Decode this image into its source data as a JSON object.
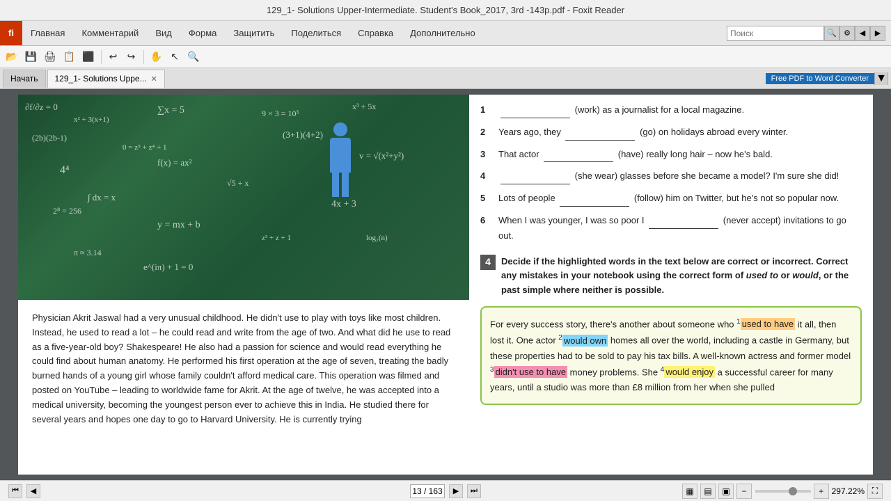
{
  "titleBar": {
    "title": "129_1- Solutions Upper-Intermediate. Student's Book_2017, 3rd -143p.pdf - Foxit Reader"
  },
  "menuBar": {
    "appLabel": "fi",
    "items": [
      "Главная",
      "Комментарий",
      "Вид",
      "Форма",
      "Защитить",
      "Поделиться",
      "Справка",
      "Дополнительно"
    ],
    "search": {
      "placeholder": "Поиск"
    }
  },
  "toolbar": {
    "buttons": [
      "💾",
      "🖨",
      "📋",
      "⬛",
      "↩",
      "↪",
      "🖊"
    ]
  },
  "tabs": {
    "home": "Начать",
    "current": "129_1- Solutions Uppe...",
    "converter": "Free PDF to Word Converter"
  },
  "leftPage": {
    "bodyText": "Physician Akrit Jaswal had a very unusual childhood. He didn't use to play with toys like most children. Instead, he used to read a lot – he could read and write from the age of two. And what did he use to read as a five-year-old boy? Shakespeare! He also had a passion for science and would read everything he could find about human anatomy. He performed his first operation at the age of seven, treating the badly burned hands of a young girl whose family couldn't afford medical care. This operation was filmed and posted on YouTube – leading to worldwide fame for Akrit. At the age of twelve, he was accepted into a medical university, becoming the youngest person ever to achieve this in India. He studied there for several years and hopes one day to go to Harvard University. He is currently trying"
  },
  "rightPage": {
    "exercises": [
      {
        "num": "1",
        "before": "",
        "blank": "________________",
        "after": "(work) as a journalist for a local magazine."
      },
      {
        "num": "2",
        "before": "Years ago, they",
        "blank": "________________",
        "after": "(go) on holidays abroad every winter."
      },
      {
        "num": "3",
        "before": "That actor",
        "blank": "________________",
        "after": "(have) really long hair – now he's bald."
      },
      {
        "num": "4",
        "before": "",
        "blank": "________________",
        "after": "(she wear) glasses before she became a model? I'm sure she did!"
      },
      {
        "num": "5",
        "before": "Lots of people",
        "blank": "________________",
        "after": "(follow) him on Twitter, but he's not so popular now."
      },
      {
        "num": "6",
        "before": "When I was younger, I was so poor I",
        "blank": "________________",
        "after": "(never accept) invitations to go out."
      }
    ],
    "section4": {
      "num": "4",
      "title": "Decide if the highlighted words in the text below are correct or incorrect. Correct any mistakes in your notebook using the correct form of",
      "italicUsedTo": "used to",
      "or": "or",
      "italicWould": "would",
      "rest": ", or the past simple where neither is possible."
    },
    "highlightedText": {
      "intro": "For every success story, there's another about someone who ",
      "sup1": "1",
      "hl1": "used to have",
      "mid1": " it all, then lost it. One actor ",
      "sup2": "2",
      "hl2": "would own",
      "mid2": " homes all over the world, including a castle in Germany, but these properties had to be sold to pay his tax bills. A well-known actress and former model ",
      "sup3": "3",
      "hl3": "didn't use to have",
      "mid3": " money problems. She ",
      "sup4": "4",
      "hl4": "would enjoy",
      "mid4": " a successful career for many years, until a studio was more than £8 million from her when she pulled..."
    }
  },
  "bottomBar": {
    "pageNum": "13 / 163",
    "zoomLevel": "297.22%",
    "navButtons": [
      "⏮",
      "◀",
      "▶",
      "⏭"
    ]
  }
}
